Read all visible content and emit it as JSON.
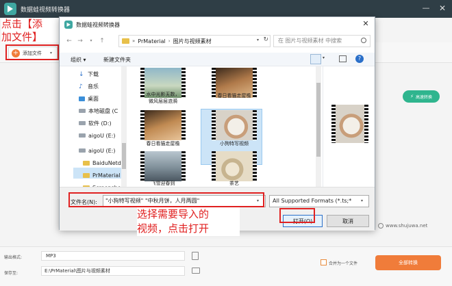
{
  "app": {
    "title": "数据蛙视频转换器",
    "minimize_glyph": "—",
    "close_glyph": "✕",
    "toolbar": {
      "add_file_label": "添加文件",
      "add_file_icon": "+",
      "add_caret": "▾",
      "fast_convert_label": "高速转换",
      "fast_convert_icon": "⚡"
    },
    "callout_add": [
      "点击【添",
      "加文件】"
    ],
    "bottom": {
      "output_format_label": "输出格式:",
      "output_format_value": "MP3",
      "save_to_label": "保存至:",
      "save_to_value": "E:\\PrMaterial\\图片与视频素材",
      "merge_label": "合并为一个文件",
      "convert_all_label": "全部转换"
    },
    "watermark": "www.shujuwa.net"
  },
  "dialog": {
    "title": "数据蛙视频转换器",
    "close_glyph": "✕",
    "nav": {
      "back": "←",
      "forward": "→",
      "recent": "▾",
      "up": "↑",
      "address_sep": "»",
      "address_segments": [
        "PrMaterial",
        "图片与视频素材"
      ],
      "address_caret": "▾",
      "refresh": "↻",
      "search_placeholder": "在 图片与视频素材 中搜索"
    },
    "commands": {
      "organize": "组织 ▾",
      "new_folder": "新建文件夹",
      "view_caret": "▾",
      "help": "?"
    },
    "nav_pane": {
      "items": [
        {
          "label": "下载",
          "icon": "download-icon"
        },
        {
          "label": "音乐",
          "icon": "music-icon"
        },
        {
          "label": "桌面",
          "icon": "desktop-icon"
        },
        {
          "label": "本地磁盘 (C",
          "icon": "disk-icon"
        },
        {
          "label": "软件 (D:)",
          "icon": "disk-icon"
        },
        {
          "label": "aigoU (E:)",
          "icon": "usb-icon"
        },
        {
          "label": "aigoU (E:)",
          "icon": "usb-icon"
        },
        {
          "label": "BaiduNetd",
          "icon": "folder-icon"
        },
        {
          "label": "PrMaterial",
          "icon": "folder-icon"
        },
        {
          "label": "Screensho",
          "icon": "folder-icon"
        }
      ]
    },
    "files": [
      {
        "label": "水中光影无数，\n微风层层涟漪"
      },
      {
        "label": "春日看猫走屋檐"
      },
      {
        "label": "春日看猫走屋檐"
      },
      {
        "label": "小狗特写视频"
      },
      {
        "label": "飞雪迎春到"
      },
      {
        "label": "茶艺"
      }
    ],
    "bottom": {
      "filename_label": "文件名(N):",
      "filename_value": "\"小狗特写视频\" \"中秋月饼，人月两圆\"",
      "filename_caret": "▾",
      "format_value": "All Supported Formats (*.ts;*",
      "format_caret": "▾",
      "open_label": "打开(O)",
      "cancel_label": "取消"
    }
  },
  "instruction": [
    "选择需要导入的",
    "视频，点击打开"
  ],
  "colors": {
    "accent_orange": "#f07c3a",
    "accent_green": "#2fb58e",
    "highlight_red": "#e02020",
    "selection_blue": "#cce4f7"
  }
}
